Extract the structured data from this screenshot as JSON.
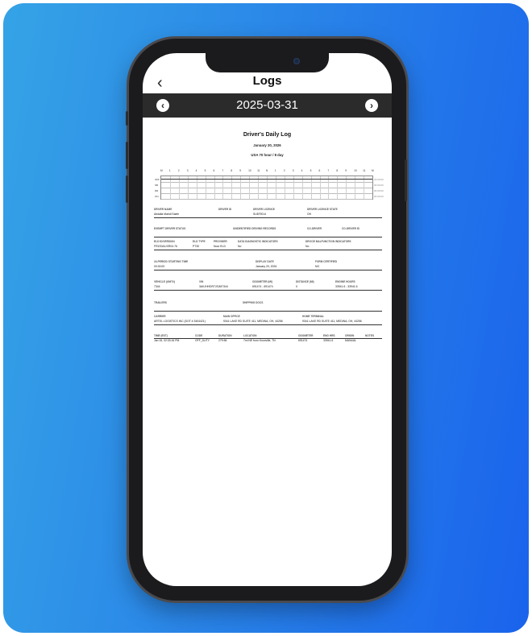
{
  "app": {
    "title": "Logs",
    "date": "2025-03-31",
    "back_icon": "back-arrow-icon",
    "prev_icon": "chevron-left-icon",
    "next_icon": "chevron-right-icon"
  },
  "log": {
    "title": "Driver's Daily Log",
    "date": "January 20, 2026",
    "cycle": "USA 70 hour / 8 day",
    "hours": [
      "M",
      "1",
      "2",
      "3",
      "4",
      "5",
      "6",
      "7",
      "8",
      "9",
      "10",
      "11",
      "N",
      "1",
      "2",
      "3",
      "4",
      "5",
      "6",
      "7",
      "8",
      "9",
      "10",
      "11",
      "M"
    ],
    "rows": [
      "OFF",
      "SB",
      "DR",
      "ON"
    ],
    "totals": [
      "24:00:00",
      "00:00:00",
      "00:00:00",
      "00:00:00"
    ],
    "driver": {
      "headers": [
        "DRIVER NAME",
        "DRIVER ID",
        "DRIVER LICENCE",
        "DRIVER LICENCE STATE"
      ],
      "values": [
        "Abdalla Mahdi Saleh",
        "",
        "SU879014",
        "OH"
      ]
    },
    "exempt": {
      "headers": [
        "EXEMPT DRIVER STATUS",
        "UNIDENTIFIED DRIVING RECORDS",
        "CO-DRIVER",
        "CO-DRIVER ID"
      ],
      "values": [
        "",
        "",
        "",
        ""
      ]
    },
    "eld": {
      "headers": [
        "ELD ID/VERSION",
        "ELD TYPE",
        "PROVIDER",
        "DATA DIAGNOSTIC INDICATORS",
        "DEVICE MALFUNCTION INDICATORS"
      ],
      "values": [
        "FR1S0A1/XR04.76",
        "PT30",
        "Noor ELD",
        "No",
        "No"
      ]
    },
    "period": {
      "headers": [
        "24-PERIOD STARTING TIME",
        "DISPLAY DATE",
        "FORM CERTIFIED"
      ],
      "values": [
        "00:00:00",
        "January 20, 2026",
        "NO"
      ]
    },
    "vehicle": {
      "headers": [
        "VEHICLE (UNIT#)",
        "VIN",
        "ODOMETER (MI)",
        "DISTANCE (MI)",
        "ENGINE HOURS"
      ],
      "values": [
        "7344",
        "3AKJHHDR7JSJM7344",
        "691474 - 691474",
        "0",
        "33941.6 - 33941.6"
      ]
    },
    "trailers": {
      "headers": [
        "TRAILERS",
        "SHIPPING DOCS"
      ],
      "values": [
        "",
        ""
      ]
    },
    "carrier": {
      "headers": [
        "CARRIER",
        "MAIN OFFICE",
        "HOME TERMINAL"
      ],
      "values": [
        "ARTEL LOGISTICS INC (DOT # 3404421)",
        "9341 LAKE RD SUITE 411, MEDINA, OH, 44256",
        "9341 LAKE RD SUITE 411, MEDINA, OH, 44256"
      ]
    },
    "events": {
      "headers": [
        "TIME (EST)",
        "CODE",
        "DURATION",
        "LOCATION",
        "ODOMETER",
        "ENG HRS",
        "ORIGIN",
        "NOTES"
      ],
      "rows": [
        [
          "Jan 15, 02:33:16 PM",
          "OFF_DUTY",
          "279:56",
          "7mi NE from Knoxville, TN",
          "691474",
          "33941.6",
          "MANUAL",
          ""
        ]
      ]
    }
  }
}
